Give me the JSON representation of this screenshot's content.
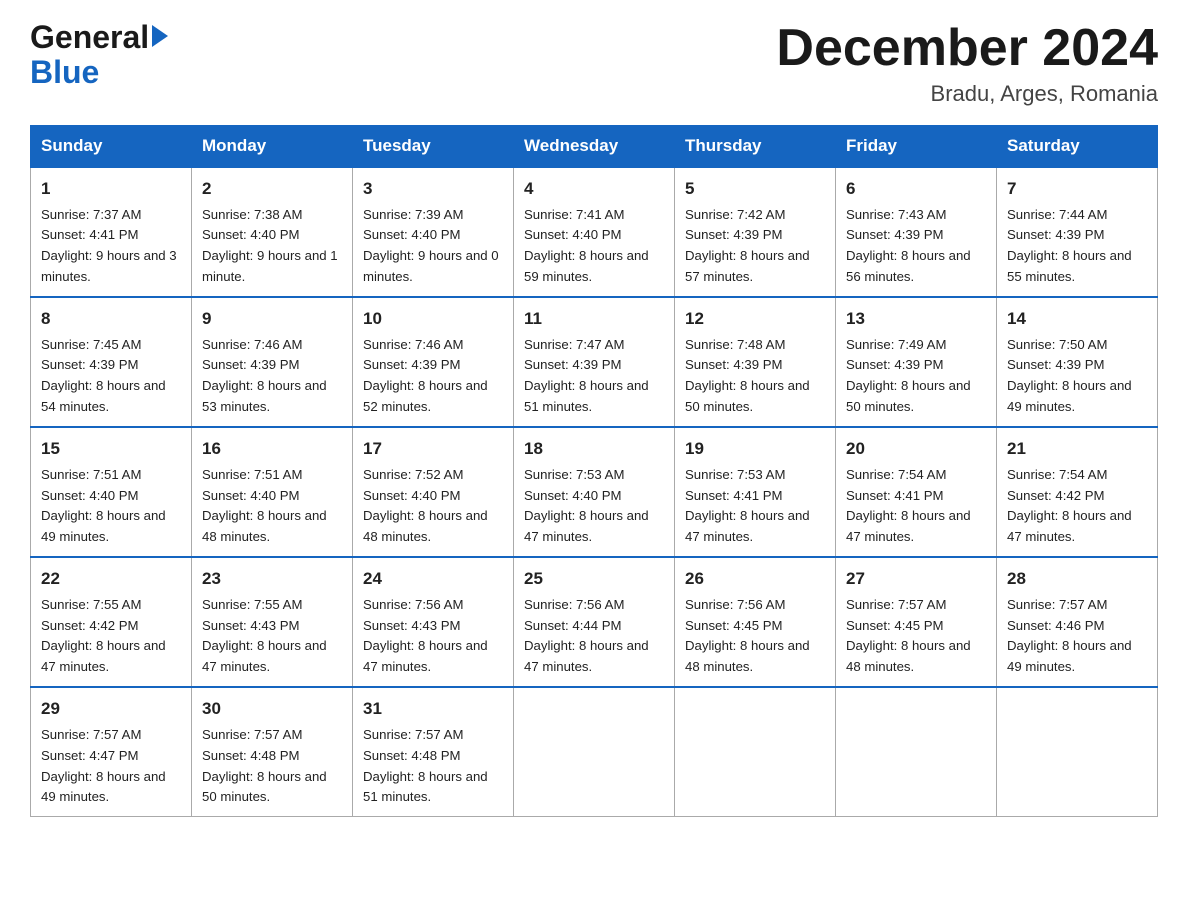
{
  "header": {
    "logo_line1": "General",
    "logo_line2": "Blue",
    "month_title": "December 2024",
    "location": "Bradu, Arges, Romania"
  },
  "days_of_week": [
    "Sunday",
    "Monday",
    "Tuesday",
    "Wednesday",
    "Thursday",
    "Friday",
    "Saturday"
  ],
  "weeks": [
    [
      {
        "day": "1",
        "sunrise": "7:37 AM",
        "sunset": "4:41 PM",
        "daylight": "9 hours and 3 minutes."
      },
      {
        "day": "2",
        "sunrise": "7:38 AM",
        "sunset": "4:40 PM",
        "daylight": "9 hours and 1 minute."
      },
      {
        "day": "3",
        "sunrise": "7:39 AM",
        "sunset": "4:40 PM",
        "daylight": "9 hours and 0 minutes."
      },
      {
        "day": "4",
        "sunrise": "7:41 AM",
        "sunset": "4:40 PM",
        "daylight": "8 hours and 59 minutes."
      },
      {
        "day": "5",
        "sunrise": "7:42 AM",
        "sunset": "4:39 PM",
        "daylight": "8 hours and 57 minutes."
      },
      {
        "day": "6",
        "sunrise": "7:43 AM",
        "sunset": "4:39 PM",
        "daylight": "8 hours and 56 minutes."
      },
      {
        "day": "7",
        "sunrise": "7:44 AM",
        "sunset": "4:39 PM",
        "daylight": "8 hours and 55 minutes."
      }
    ],
    [
      {
        "day": "8",
        "sunrise": "7:45 AM",
        "sunset": "4:39 PM",
        "daylight": "8 hours and 54 minutes."
      },
      {
        "day": "9",
        "sunrise": "7:46 AM",
        "sunset": "4:39 PM",
        "daylight": "8 hours and 53 minutes."
      },
      {
        "day": "10",
        "sunrise": "7:46 AM",
        "sunset": "4:39 PM",
        "daylight": "8 hours and 52 minutes."
      },
      {
        "day": "11",
        "sunrise": "7:47 AM",
        "sunset": "4:39 PM",
        "daylight": "8 hours and 51 minutes."
      },
      {
        "day": "12",
        "sunrise": "7:48 AM",
        "sunset": "4:39 PM",
        "daylight": "8 hours and 50 minutes."
      },
      {
        "day": "13",
        "sunrise": "7:49 AM",
        "sunset": "4:39 PM",
        "daylight": "8 hours and 50 minutes."
      },
      {
        "day": "14",
        "sunrise": "7:50 AM",
        "sunset": "4:39 PM",
        "daylight": "8 hours and 49 minutes."
      }
    ],
    [
      {
        "day": "15",
        "sunrise": "7:51 AM",
        "sunset": "4:40 PM",
        "daylight": "8 hours and 49 minutes."
      },
      {
        "day": "16",
        "sunrise": "7:51 AM",
        "sunset": "4:40 PM",
        "daylight": "8 hours and 48 minutes."
      },
      {
        "day": "17",
        "sunrise": "7:52 AM",
        "sunset": "4:40 PM",
        "daylight": "8 hours and 48 minutes."
      },
      {
        "day": "18",
        "sunrise": "7:53 AM",
        "sunset": "4:40 PM",
        "daylight": "8 hours and 47 minutes."
      },
      {
        "day": "19",
        "sunrise": "7:53 AM",
        "sunset": "4:41 PM",
        "daylight": "8 hours and 47 minutes."
      },
      {
        "day": "20",
        "sunrise": "7:54 AM",
        "sunset": "4:41 PM",
        "daylight": "8 hours and 47 minutes."
      },
      {
        "day": "21",
        "sunrise": "7:54 AM",
        "sunset": "4:42 PM",
        "daylight": "8 hours and 47 minutes."
      }
    ],
    [
      {
        "day": "22",
        "sunrise": "7:55 AM",
        "sunset": "4:42 PM",
        "daylight": "8 hours and 47 minutes."
      },
      {
        "day": "23",
        "sunrise": "7:55 AM",
        "sunset": "4:43 PM",
        "daylight": "8 hours and 47 minutes."
      },
      {
        "day": "24",
        "sunrise": "7:56 AM",
        "sunset": "4:43 PM",
        "daylight": "8 hours and 47 minutes."
      },
      {
        "day": "25",
        "sunrise": "7:56 AM",
        "sunset": "4:44 PM",
        "daylight": "8 hours and 47 minutes."
      },
      {
        "day": "26",
        "sunrise": "7:56 AM",
        "sunset": "4:45 PM",
        "daylight": "8 hours and 48 minutes."
      },
      {
        "day": "27",
        "sunrise": "7:57 AM",
        "sunset": "4:45 PM",
        "daylight": "8 hours and 48 minutes."
      },
      {
        "day": "28",
        "sunrise": "7:57 AM",
        "sunset": "4:46 PM",
        "daylight": "8 hours and 49 minutes."
      }
    ],
    [
      {
        "day": "29",
        "sunrise": "7:57 AM",
        "sunset": "4:47 PM",
        "daylight": "8 hours and 49 minutes."
      },
      {
        "day": "30",
        "sunrise": "7:57 AM",
        "sunset": "4:48 PM",
        "daylight": "8 hours and 50 minutes."
      },
      {
        "day": "31",
        "sunrise": "7:57 AM",
        "sunset": "4:48 PM",
        "daylight": "8 hours and 51 minutes."
      },
      null,
      null,
      null,
      null
    ]
  ],
  "labels": {
    "sunrise": "Sunrise:",
    "sunset": "Sunset:",
    "daylight": "Daylight:"
  }
}
